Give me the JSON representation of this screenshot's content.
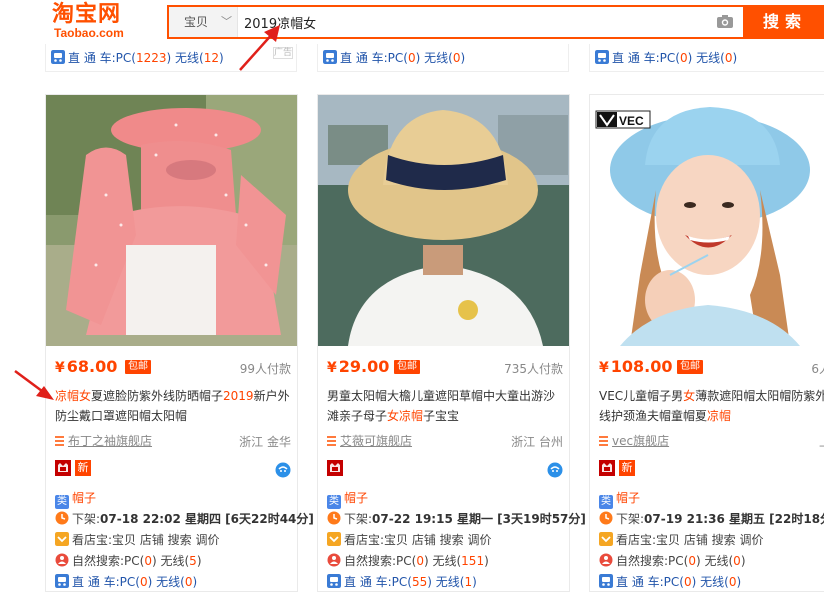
{
  "header": {
    "logo_cn": "淘宝网",
    "logo_en": "Taobao.com",
    "search_type": "宝贝",
    "search_value": "2019凉帽女",
    "search_button": "搜索"
  },
  "top_row": [
    {
      "label": "直 通 车:PC(",
      "pc": "1223",
      "mid": ") 无线(",
      "wx": "12",
      "end": ")",
      "badge": "广告"
    },
    {
      "label": "直 通 车:PC(",
      "pc": "0",
      "mid": ") 无线(",
      "wx": "0",
      "end": ")"
    },
    {
      "label": "直 通 车:PC(",
      "pc": "0",
      "mid": ") 无线(",
      "wx": "0",
      "end": ")"
    }
  ],
  "cards": [
    {
      "price": "68.00",
      "baoyou": "包邮",
      "sold": "99人付款",
      "title_parts": [
        {
          "t": "凉帽女",
          "hl": true
        },
        {
          "t": "夏遮脸防紫外线防晒帽子",
          "hl": false
        },
        {
          "t": "2019",
          "hl": true
        },
        {
          "t": "新户外防尘戴口罩遮阳帽太阳帽",
          "hl": false
        }
      ],
      "shop": "布丁之袖旗舰店",
      "location": "浙江 金华",
      "new_badge": "新",
      "category_icon": "类",
      "category": "帽子",
      "shelf": "下架:",
      "shelf_time": "07-18 22:02 星期四 [6天22时44分]",
      "store_text": "看店宝:宝贝 店铺 搜索 调价",
      "nat_label": "自然搜索:PC(",
      "nat_pc": "0",
      "nat_mid": ") 无线(",
      "nat_wx": "5",
      "nat_end": ")",
      "car_label": "直 通 车:PC(",
      "car_pc": "0",
      "car_mid": ") 无线(",
      "car_wx": "0",
      "car_end": ")"
    },
    {
      "price": "29.00",
      "baoyou": "包邮",
      "sold": "735人付款",
      "title_parts": [
        {
          "t": "男童太阳帽大檐儿童遮阳草帽中大童出游沙滩亲子母子",
          "hl": false
        },
        {
          "t": "女凉帽",
          "hl": true
        },
        {
          "t": "子宝宝",
          "hl": false
        }
      ],
      "shop": "艾薇可旗舰店",
      "location": "浙江 台州",
      "new_badge": "",
      "category_icon": "类",
      "category": "帽子",
      "shelf": "下架:",
      "shelf_time": "07-22 19:15 星期一 [3天19时57分]",
      "store_text": "看店宝:宝贝 店铺 搜索 调价",
      "nat_label": "自然搜索:PC(",
      "nat_pc": "0",
      "nat_mid": ") 无线(",
      "nat_wx": "151",
      "nat_end": ")",
      "car_label": "直 通 车:PC(",
      "car_pc": "55",
      "car_mid": ") 无线(",
      "car_wx": "1",
      "car_end": ")"
    },
    {
      "price": "108.00",
      "baoyou": "包邮",
      "sold": "6人付",
      "title_parts": [
        {
          "t": "VEC儿童帽子男",
          "hl": false
        },
        {
          "t": "女",
          "hl": true
        },
        {
          "t": "薄款遮阳帽太阳帽防紫外线护颈渔夫帽童帽夏",
          "hl": false
        },
        {
          "t": "凉帽",
          "hl": true
        }
      ],
      "shop": "vec旗舰店",
      "location": "上海",
      "new_badge": "新",
      "category_icon": "类",
      "category": "帽子",
      "shelf": "下架:",
      "shelf_time": "07-19 21:36 星期五 [22时18分]",
      "store_text": "看店宝:宝贝 店铺 搜索 调价",
      "nat_label": "自然搜索:PC(",
      "nat_pc": "0",
      "nat_mid": ") 无线(",
      "nat_wx": "0",
      "nat_end": ")",
      "car_label": "直 通 车:PC(",
      "car_pc": "0",
      "car_mid": ") 无线(",
      "car_wx": "0",
      "car_end": ")",
      "brand_mark": "VEC"
    }
  ],
  "colors": {
    "accent": "#ff5000",
    "price": "#ff4400",
    "category_badge": "#4a86e8",
    "tmall": "#c40000"
  },
  "icons": [
    "camera-icon",
    "chevron-down-icon",
    "car-icon",
    "shop-icon",
    "tmall-icon",
    "new-icon",
    "wangwang-icon",
    "category-icon",
    "clock-icon",
    "store-treasure-icon",
    "natural-search-icon",
    "annotation-arrow-icon"
  ]
}
